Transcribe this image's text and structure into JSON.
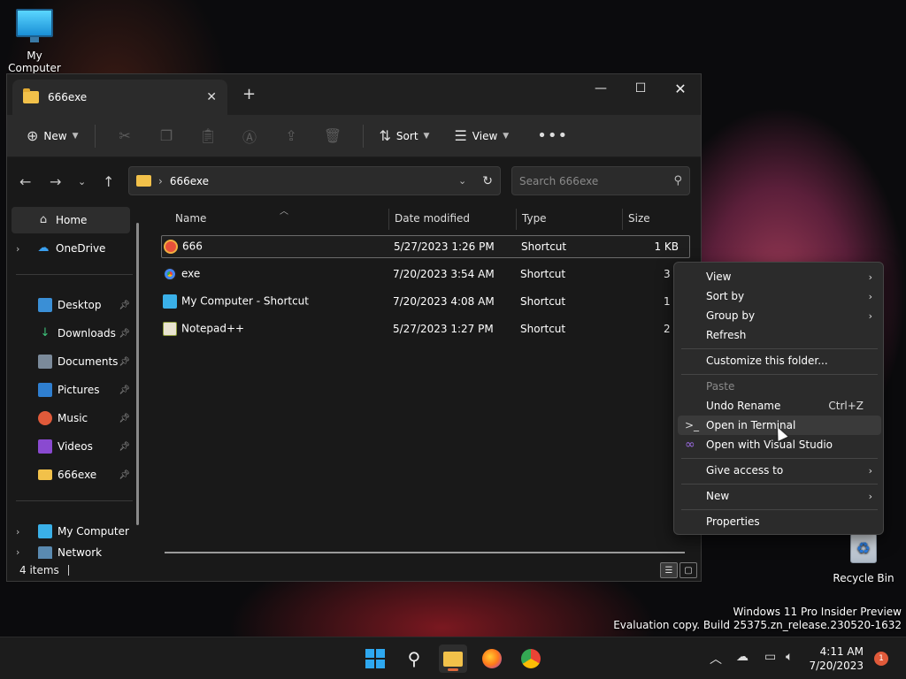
{
  "desktop": {
    "my_computer_label": "My Computer",
    "recycle_bin_label": "Recycle Bin"
  },
  "window": {
    "tab_title": "666exe",
    "toolbar": {
      "new_label": "New",
      "sort_label": "Sort",
      "view_label": "View"
    },
    "address": {
      "path": "666exe",
      "search_placeholder": "Search 666exe"
    },
    "nav": {
      "home": "Home",
      "onedrive": "OneDrive",
      "quick_access": [
        {
          "label": "Desktop"
        },
        {
          "label": "Downloads"
        },
        {
          "label": "Documents"
        },
        {
          "label": "Pictures"
        },
        {
          "label": "Music"
        },
        {
          "label": "Videos"
        },
        {
          "label": "666exe"
        }
      ],
      "my_computer": "My Computer",
      "network": "Network"
    },
    "columns": {
      "name": "Name",
      "date": "Date modified",
      "type": "Type",
      "size": "Size"
    },
    "files": [
      {
        "name": "666",
        "date": "5/27/2023 1:26 PM",
        "type": "Shortcut",
        "size": "1 KB"
      },
      {
        "name": "exe",
        "date": "7/20/2023 3:54 AM",
        "type": "Shortcut",
        "size": "3"
      },
      {
        "name": "My Computer - Shortcut",
        "date": "7/20/2023 4:08 AM",
        "type": "Shortcut",
        "size": "1"
      },
      {
        "name": "Notepad++",
        "date": "5/27/2023 1:27 PM",
        "type": "Shortcut",
        "size": "2"
      }
    ],
    "status": "4 items"
  },
  "context_menu": {
    "view": "View",
    "sort_by": "Sort by",
    "group_by": "Group by",
    "refresh": "Refresh",
    "customize": "Customize this folder...",
    "paste": "Paste",
    "undo_rename": "Undo Rename",
    "undo_shortcut": "Ctrl+Z",
    "open_terminal": "Open in Terminal",
    "open_vs": "Open with Visual Studio",
    "give_access": "Give access to",
    "new": "New",
    "properties": "Properties"
  },
  "watermark": {
    "line1": "Windows 11 Pro Insider Preview",
    "line2": "Evaluation copy. Build 25375.zn_release.230520-1632"
  },
  "taskbar": {
    "time": "4:11 AM",
    "date": "7/20/2023",
    "notifications": "1"
  },
  "colors": {
    "accent": "#2ea8f0",
    "folder": "#f2c14a",
    "notification": "#e05a3a"
  }
}
